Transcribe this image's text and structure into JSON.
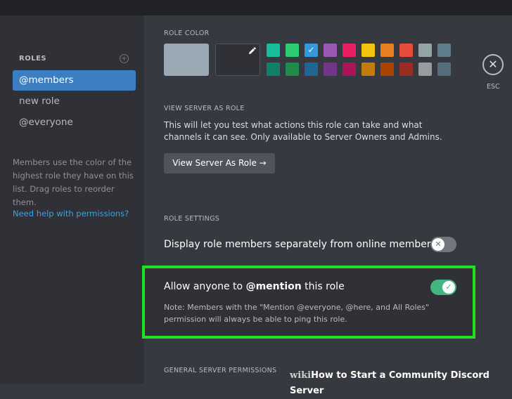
{
  "sidebar": {
    "header": "ROLES",
    "add_icon": "plus-circle-icon",
    "roles": [
      "@members",
      "new role",
      "@everyone"
    ],
    "help_text": "Members use the color of the highest role they have on this list. Drag roles to reorder them.",
    "help_link": "Need help with permissions?"
  },
  "role_color": {
    "label": "ROLE COLOR",
    "dropper_icon": "eyedropper-icon",
    "default_color": "#99aab5",
    "swatches_row1": [
      "#1abc9c",
      "#2ecc71",
      "#3498db",
      "#9b59b6",
      "#e91e63",
      "#f1c40f",
      "#e67e22",
      "#e74c3c",
      "#95a5a6",
      "#607d8b"
    ],
    "swatches_row2": [
      "#11806a",
      "#1f8b4c",
      "#206694",
      "#71368a",
      "#ad1457",
      "#c27c0e",
      "#a84300",
      "#992d22",
      "#979c9f",
      "#546e7a"
    ],
    "selected_check": "✓"
  },
  "view_as": {
    "label": "VIEW SERVER AS ROLE",
    "description": "This will let you test what actions this role can take and what channels it can see. Only available to Server Owners and Admins.",
    "button": "View Server As Role →"
  },
  "role_settings": {
    "label": "ROLE SETTINGS",
    "display_separately": "Display role members separately from online members",
    "display_separately_enabled": false,
    "mention_prefix": "Allow anyone to ",
    "mention_bold": "@mention",
    "mention_suffix": " this role",
    "mention_enabled": true,
    "mention_note": "Note: Members with the \"Mention @everyone, @here, and All Roles\" permission will always be able to ping this role.",
    "toggle_off_glyph": "✕",
    "toggle_on_glyph": "✓"
  },
  "general_permissions": {
    "label": "GENERAL SERVER PERMISSIONS"
  },
  "close": {
    "glyph": "✕",
    "label": "ESC"
  },
  "watermark": {
    "prefix": "wiki",
    "text": "How to Start a Community Discord Server"
  },
  "colors": {
    "highlight": "#20e020",
    "accent": "#3b7ec1",
    "link": "#3ca4e0",
    "toggle_on": "#43b581"
  }
}
